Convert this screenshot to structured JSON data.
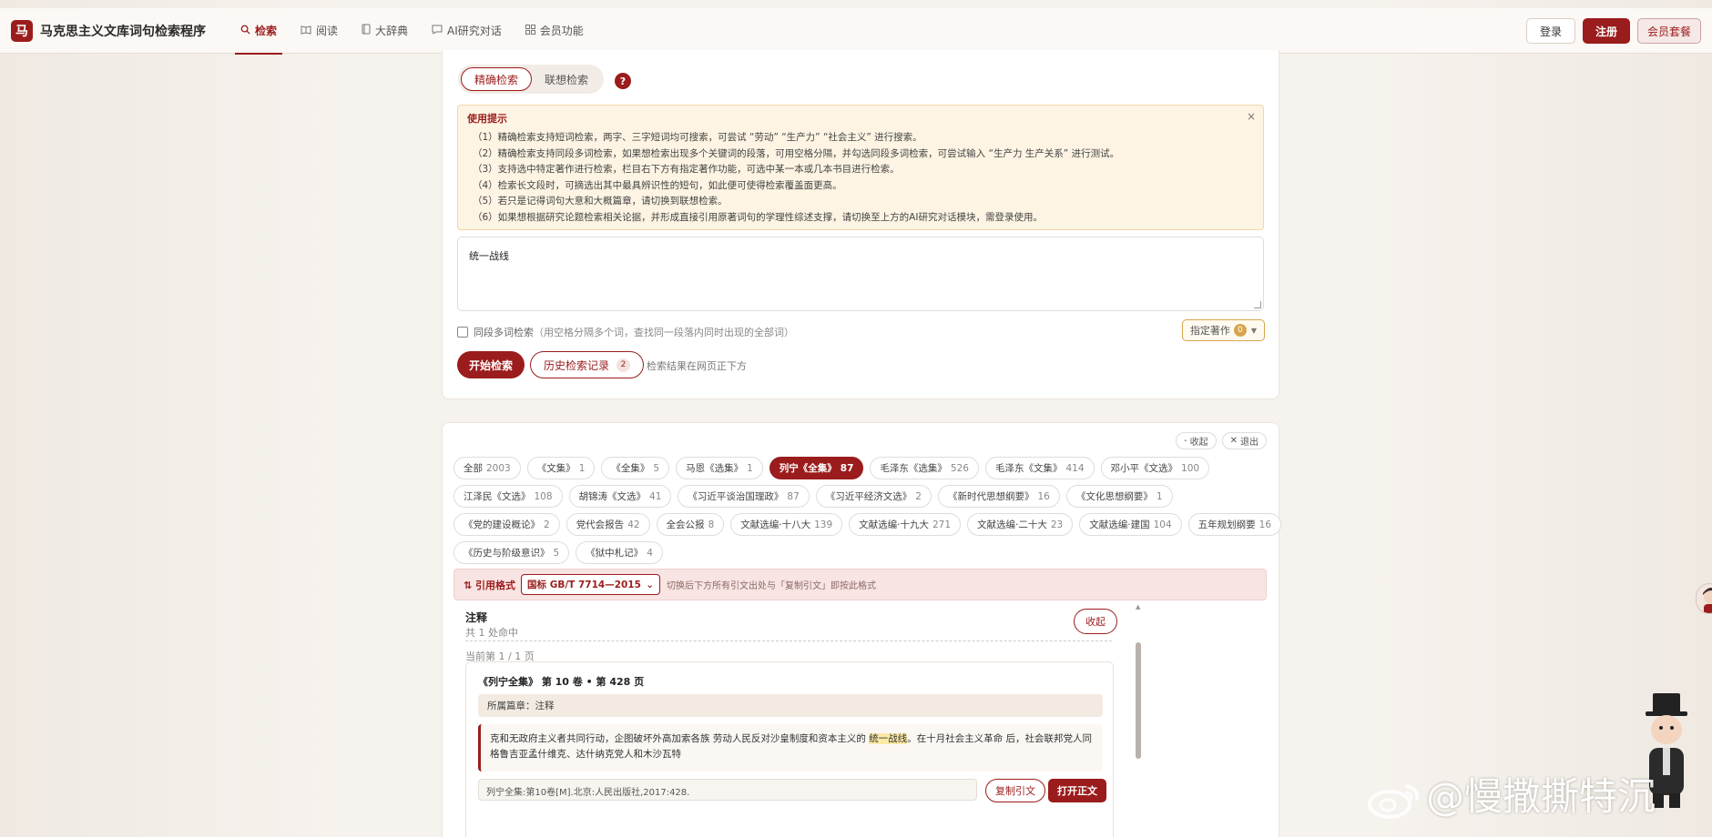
{
  "app": {
    "logo_char": "马",
    "title": "马克思主义文库词句检索程序"
  },
  "nav": {
    "items": [
      {
        "label": "检索",
        "icon": "search-icon",
        "active": true
      },
      {
        "label": "阅读",
        "icon": "book-open-icon"
      },
      {
        "label": "大辞典",
        "icon": "book-icon"
      },
      {
        "label": "AI研究对话",
        "icon": "chat-icon"
      },
      {
        "label": "会员功能",
        "icon": "grid-icon"
      }
    ],
    "login": "登录",
    "register": "注册",
    "vip": "会员套餐"
  },
  "search": {
    "modes": [
      "精确检索",
      "联想检索"
    ],
    "help": "?",
    "tips_title": "使用提示",
    "tips": [
      "（1）精确检索支持短词检索，两字、三字短词均可搜索，可尝试 “劳动” “生产力” “社会主义” 进行搜索。",
      "（2）精确检索支持同段多词检索，如果想检索出现多个关键词的段落，可用空格分隔，并勾选同段多词检索，可尝试输入 “生产力 生产关系” 进行测试。",
      "（3）支持选中特定著作进行检索，栏目右下方有指定著作功能，可选中某一本或几本书目进行检索。",
      "（4）检索长文段时，可摘选出其中最具辨识性的短句，如此便可使得检索覆盖面更高。",
      "（5）若只是记得词句大意和大概篇章，请切换到联想检索。",
      "（6）如果想根据研究论题检索相关论据，并形成直接引用原著词句的学理性综述支撑，请切换至上方的AI研究对话模块，需登录使用。"
    ],
    "tips_close": "×",
    "query": "统一战线",
    "multi_label": "同段多词检索",
    "multi_hint": "（用空格分隔多个词，查找同一段落内同时出现的全部词）",
    "spec_label": "指定著作",
    "spec_count": "0",
    "go": "开始检索",
    "history": "历史检索记录",
    "history_count": "2",
    "go_hint": "检索结果在网页正下方"
  },
  "results": {
    "collapse_all": "收起",
    "exit": "退出",
    "chip_rows": [
      [
        {
          "name": "全部",
          "count": "2003"
        },
        {
          "name": "《文集》",
          "count": "1"
        },
        {
          "name": "《全集》",
          "count": "5"
        },
        {
          "name": "马恩《选集》",
          "count": "1"
        },
        {
          "name": "列宁《全集》",
          "count": "87",
          "active": true
        },
        {
          "name": "毛泽东《选集》",
          "count": "526"
        },
        {
          "name": "毛泽东《文集》",
          "count": "414"
        },
        {
          "name": "邓小平《文选》",
          "count": "100"
        }
      ],
      [
        {
          "name": "江泽民《文选》",
          "count": "108"
        },
        {
          "name": "胡锦涛《文选》",
          "count": "41"
        },
        {
          "name": "《习近平谈治国理政》",
          "count": "87"
        },
        {
          "name": "《习近平经济文选》",
          "count": "2"
        },
        {
          "name": "《新时代思想纲要》",
          "count": "16"
        },
        {
          "name": "《文化思想纲要》",
          "count": "1"
        }
      ],
      [
        {
          "name": "《党的建设概论》",
          "count": "2"
        },
        {
          "name": "党代会报告",
          "count": "42"
        },
        {
          "name": "全会公报",
          "count": "8"
        },
        {
          "name": "文献选编·十八大",
          "count": "139"
        },
        {
          "name": "文献选编·十九大",
          "count": "271"
        },
        {
          "name": "文献选编·二十大",
          "count": "23"
        },
        {
          "name": "文献选编·建国",
          "count": "104"
        },
        {
          "name": "五年规划纲要",
          "count": "16"
        }
      ],
      [
        {
          "name": "《历史与阶级意识》",
          "count": "5"
        },
        {
          "name": "《狱中札记》",
          "count": "4"
        }
      ]
    ],
    "cite_label": "引用格式",
    "cite_value": "国标 GB/T 7714—2015",
    "cite_hint": "切换后下方所有引文出处与「复制引文」即按此格式",
    "notes_title": "注释",
    "notes_sub": "共 1 处命中",
    "notes_collapse": "收起",
    "page": "当前第 1 / 1 页",
    "item": {
      "title": "《列宁全集》 第 10 卷 • 第 428 页",
      "section": "所属篇章：注释",
      "quote_pre": "克和无政府主义者共同行动，企图破坏外高加索各族 劳动人民反对沙皇制度和资本主义的 ",
      "quote_hl": "统一战线",
      "quote_post": "。在十月社会主义革命 后，社会联邦党人同格鲁吉亚孟什维克、达什纳克党人和木沙瓦特",
      "source": "列宁全集:第10卷[M].北京:人民出版社,2017:428.",
      "copy": "复制引文",
      "open": "打开正文"
    }
  },
  "watermark": "@慢撒撕特沉"
}
